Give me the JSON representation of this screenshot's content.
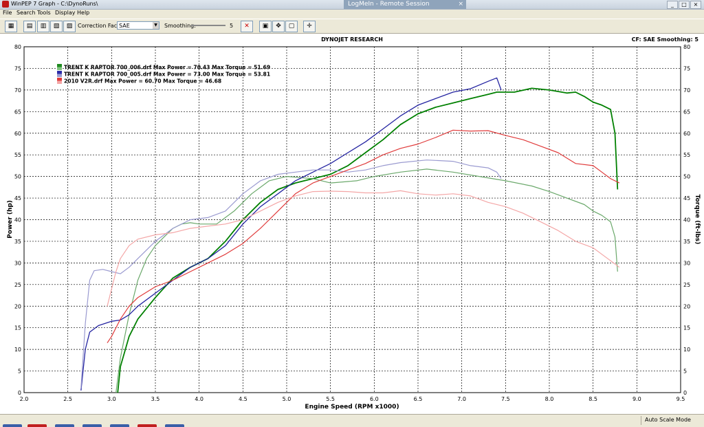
{
  "window": {
    "app_title": "WinPEP 7    Graph - C:\\DynoRuns\\",
    "remote_title": "LogMeIn - Remote Session",
    "remote_close": "×"
  },
  "menu": [
    "File",
    "Search",
    "Tools",
    "Display",
    "Help"
  ],
  "toolbar": {
    "correction_label": "Correction Factor:",
    "correction_value": "SAE",
    "smoothing_label": "Smoothing:",
    "smoothing_value": "5"
  },
  "header": {
    "company": "DYNOJET RESEARCH",
    "cf_info": "CF: SAE  Smoothing: 5"
  },
  "status": {
    "mode": "Auto Scale Mode"
  },
  "chart_data": {
    "type": "line",
    "xlabel": "Engine Speed (RPM x1000)",
    "ylabel_left": "Power (hp)",
    "ylabel_right": "Torque (ft-lbs)",
    "xlim": [
      2.0,
      9.5
    ],
    "ylim": [
      0,
      80
    ],
    "x_ticks": [
      "2.0",
      "2.5",
      "3.0",
      "3.5",
      "4.0",
      "4.5",
      "5.0",
      "5.5",
      "6.0",
      "6.5",
      "7.0",
      "7.5",
      "8.0",
      "8.5",
      "9.0",
      "9.5"
    ],
    "y_ticks": [
      "0",
      "5",
      "10",
      "15",
      "20",
      "25",
      "30",
      "35",
      "40",
      "45",
      "50",
      "55",
      "60",
      "65",
      "70",
      "75",
      "80"
    ],
    "grid": true,
    "legend_position": "top-left",
    "legend": [
      "TRENT K RAPTOR 700_006.drf Max Power = 70.43 Max Torque = 51.69",
      "TRENT K RAPTOR 700_005.drf Max Power = 73.00 Max Torque = 53.81",
      "2010 V2R.drf Max Power = 60.70 Max Torque = 46.68"
    ],
    "series": [
      {
        "color": "#008000",
        "kind": "power",
        "width": 1.8,
        "points": [
          [
            3.07,
            0
          ],
          [
            3.1,
            6
          ],
          [
            3.2,
            13
          ],
          [
            3.3,
            17
          ],
          [
            3.5,
            22
          ],
          [
            3.7,
            26.5
          ],
          [
            3.9,
            29
          ],
          [
            4.1,
            31
          ],
          [
            4.3,
            35
          ],
          [
            4.5,
            40
          ],
          [
            4.7,
            44
          ],
          [
            4.9,
            47
          ],
          [
            5.1,
            48.5
          ],
          [
            5.3,
            49.5
          ],
          [
            5.5,
            50.5
          ],
          [
            5.7,
            52.5
          ],
          [
            5.9,
            55.5
          ],
          [
            6.1,
            58.5
          ],
          [
            6.3,
            62
          ],
          [
            6.5,
            64.5
          ],
          [
            6.7,
            66
          ],
          [
            6.9,
            67
          ],
          [
            7.1,
            68
          ],
          [
            7.3,
            69
          ],
          [
            7.4,
            69.5
          ],
          [
            7.6,
            69.5
          ],
          [
            7.8,
            70.4
          ],
          [
            8.0,
            70
          ],
          [
            8.2,
            69.3
          ],
          [
            8.3,
            69.5
          ],
          [
            8.4,
            68.5
          ],
          [
            8.5,
            67.2
          ],
          [
            8.6,
            66.5
          ],
          [
            8.7,
            65.5
          ],
          [
            8.75,
            60
          ],
          [
            8.78,
            47
          ]
        ]
      },
      {
        "color": "#6aa86a",
        "kind": "torque",
        "width": 1.2,
        "points": [
          [
            3.05,
            0
          ],
          [
            3.1,
            8
          ],
          [
            3.2,
            18
          ],
          [
            3.3,
            26
          ],
          [
            3.4,
            31
          ],
          [
            3.5,
            34
          ],
          [
            3.6,
            36
          ],
          [
            3.7,
            38
          ],
          [
            3.8,
            39
          ],
          [
            3.9,
            39.3
          ],
          [
            4.0,
            39
          ],
          [
            4.2,
            39
          ],
          [
            4.4,
            42
          ],
          [
            4.6,
            46
          ],
          [
            4.8,
            49
          ],
          [
            5.0,
            50
          ],
          [
            5.3,
            49.5
          ],
          [
            5.5,
            48.5
          ],
          [
            5.8,
            49
          ],
          [
            6.0,
            50
          ],
          [
            6.3,
            51
          ],
          [
            6.6,
            51.7
          ],
          [
            6.9,
            51
          ],
          [
            7.2,
            50
          ],
          [
            7.5,
            49
          ],
          [
            7.8,
            47.8
          ],
          [
            8.0,
            46.5
          ],
          [
            8.2,
            45
          ],
          [
            8.4,
            43.5
          ],
          [
            8.5,
            42
          ],
          [
            8.6,
            41
          ],
          [
            8.7,
            39.5
          ],
          [
            8.75,
            36
          ],
          [
            8.78,
            28
          ]
        ]
      },
      {
        "color": "#2222a0",
        "kind": "power",
        "width": 1.3,
        "points": [
          [
            2.65,
            0.5
          ],
          [
            2.7,
            10
          ],
          [
            2.75,
            14
          ],
          [
            2.85,
            15.5
          ],
          [
            3.0,
            16.5
          ],
          [
            3.1,
            16.8
          ],
          [
            3.2,
            18
          ],
          [
            3.3,
            20
          ],
          [
            3.5,
            23
          ],
          [
            3.7,
            26
          ],
          [
            3.9,
            29
          ],
          [
            4.1,
            31
          ],
          [
            4.3,
            34
          ],
          [
            4.5,
            39
          ],
          [
            4.7,
            43
          ],
          [
            4.9,
            46
          ],
          [
            5.1,
            49
          ],
          [
            5.3,
            51
          ],
          [
            5.5,
            53
          ],
          [
            5.7,
            55.5
          ],
          [
            5.9,
            58
          ],
          [
            6.1,
            61
          ],
          [
            6.3,
            64
          ],
          [
            6.5,
            66.5
          ],
          [
            6.7,
            68
          ],
          [
            6.9,
            69.5
          ],
          [
            7.1,
            70.3
          ],
          [
            7.3,
            72
          ],
          [
            7.4,
            72.8
          ],
          [
            7.45,
            70
          ]
        ]
      },
      {
        "color": "#9a9ad0",
        "kind": "torque",
        "width": 1.2,
        "points": [
          [
            2.65,
            1
          ],
          [
            2.7,
            16
          ],
          [
            2.75,
            26
          ],
          [
            2.8,
            28.2
          ],
          [
            2.9,
            28.5
          ],
          [
            3.0,
            28
          ],
          [
            3.1,
            27.5
          ],
          [
            3.2,
            29
          ],
          [
            3.3,
            31
          ],
          [
            3.5,
            35
          ],
          [
            3.7,
            38
          ],
          [
            3.9,
            40
          ],
          [
            4.1,
            40.5
          ],
          [
            4.3,
            42
          ],
          [
            4.5,
            46
          ],
          [
            4.7,
            49
          ],
          [
            4.9,
            50.5
          ],
          [
            5.1,
            51
          ],
          [
            5.3,
            51.5
          ],
          [
            5.5,
            51.5
          ],
          [
            5.7,
            51
          ],
          [
            5.9,
            51.5
          ],
          [
            6.1,
            52.5
          ],
          [
            6.3,
            53.2
          ],
          [
            6.6,
            53.8
          ],
          [
            6.9,
            53.5
          ],
          [
            7.1,
            52.5
          ],
          [
            7.3,
            52
          ],
          [
            7.4,
            51
          ],
          [
            7.45,
            49.5
          ]
        ]
      },
      {
        "color": "#e03a3a",
        "kind": "power",
        "width": 1.2,
        "points": [
          [
            2.95,
            11.5
          ],
          [
            3.0,
            13
          ],
          [
            3.1,
            17
          ],
          [
            3.2,
            20
          ],
          [
            3.3,
            22
          ],
          [
            3.5,
            24.5
          ],
          [
            3.7,
            26
          ],
          [
            3.9,
            28
          ],
          [
            4.1,
            30
          ],
          [
            4.3,
            32
          ],
          [
            4.5,
            34.5
          ],
          [
            4.7,
            38
          ],
          [
            4.9,
            42
          ],
          [
            5.1,
            46
          ],
          [
            5.3,
            48.5
          ],
          [
            5.5,
            50
          ],
          [
            5.7,
            51.5
          ],
          [
            5.9,
            53
          ],
          [
            6.1,
            55
          ],
          [
            6.3,
            56.5
          ],
          [
            6.5,
            57.5
          ],
          [
            6.7,
            59
          ],
          [
            6.9,
            60.7
          ],
          [
            7.1,
            60.5
          ],
          [
            7.3,
            60.6
          ],
          [
            7.5,
            59.5
          ],
          [
            7.7,
            58.5
          ],
          [
            7.9,
            57
          ],
          [
            8.1,
            55.5
          ],
          [
            8.3,
            53
          ],
          [
            8.5,
            52.5
          ],
          [
            8.6,
            51
          ],
          [
            8.7,
            49.5
          ],
          [
            8.8,
            48.5
          ]
        ]
      },
      {
        "color": "#f4a6a6",
        "kind": "torque",
        "width": 1.2,
        "points": [
          [
            2.95,
            20
          ],
          [
            3.0,
            24
          ],
          [
            3.05,
            28
          ],
          [
            3.1,
            31
          ],
          [
            3.2,
            34
          ],
          [
            3.3,
            35.5
          ],
          [
            3.5,
            36.5
          ],
          [
            3.7,
            37
          ],
          [
            3.9,
            38
          ],
          [
            4.1,
            38.5
          ],
          [
            4.3,
            39
          ],
          [
            4.5,
            40
          ],
          [
            4.7,
            42
          ],
          [
            4.9,
            44
          ],
          [
            5.1,
            45.5
          ],
          [
            5.3,
            46.5
          ],
          [
            5.5,
            46.6
          ],
          [
            5.7,
            46.5
          ],
          [
            5.9,
            46.2
          ],
          [
            6.1,
            46.2
          ],
          [
            6.3,
            46.7
          ],
          [
            6.5,
            46
          ],
          [
            6.7,
            45.7
          ],
          [
            6.9,
            46
          ],
          [
            7.1,
            45.5
          ],
          [
            7.3,
            44
          ],
          [
            7.5,
            43
          ],
          [
            7.7,
            41.5
          ],
          [
            7.9,
            39.5
          ],
          [
            8.1,
            37.5
          ],
          [
            8.3,
            35
          ],
          [
            8.5,
            33.5
          ],
          [
            8.6,
            32
          ],
          [
            8.7,
            30.5
          ],
          [
            8.8,
            29
          ]
        ]
      }
    ]
  }
}
